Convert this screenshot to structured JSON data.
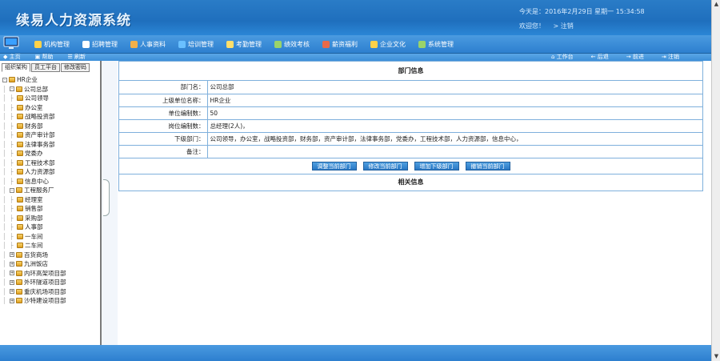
{
  "header": {
    "title": "续易人力资源系统",
    "date_line": "今天是：2016年2月29日  星期一  15:34:58",
    "welcome": "欢迎您！",
    "logout": "> 注销"
  },
  "mainnav": {
    "items": [
      {
        "label": "机构管理",
        "icon_color": "#ffd24a"
      },
      {
        "label": "招聘管理",
        "icon_color": "#ffffff"
      },
      {
        "label": "人事资料",
        "icon_color": "#f2b04a"
      },
      {
        "label": "培训管理",
        "icon_color": "#6ac0ff"
      },
      {
        "label": "考勤管理",
        "icon_color": "#ffdf6a"
      },
      {
        "label": "绩效考核",
        "icon_color": "#9ad36a"
      },
      {
        "label": "薪资福利",
        "icon_color": "#e86a4a"
      },
      {
        "label": "企业文化",
        "icon_color": "#ffd24a"
      },
      {
        "label": "系统管理",
        "icon_color": "#9ad36a"
      }
    ]
  },
  "subbar": {
    "left": [
      "◆ 主页",
      "▣ 帮助",
      "☰ 刷新"
    ],
    "right": [
      "⌂ 工作台",
      "← 后退",
      "→ 前进",
      "⇥ 注销"
    ]
  },
  "lefttabs": [
    "组织架构",
    "员工平台",
    "修改密码"
  ],
  "tree": [
    {
      "label": "HR企业",
      "depth": 0,
      "box": "-"
    },
    {
      "label": "公司总部",
      "depth": 1,
      "box": "-"
    },
    {
      "label": "公司领导",
      "depth": 2
    },
    {
      "label": "办公室",
      "depth": 2
    },
    {
      "label": "战略投资部",
      "depth": 2
    },
    {
      "label": "财务部",
      "depth": 2
    },
    {
      "label": "资产审计部",
      "depth": 2
    },
    {
      "label": "法律事务部",
      "depth": 2
    },
    {
      "label": "党委办",
      "depth": 2
    },
    {
      "label": "工程技术部",
      "depth": 2
    },
    {
      "label": "人力资源部",
      "depth": 2
    },
    {
      "label": "信息中心",
      "depth": 2
    },
    {
      "label": "工程服务厂",
      "depth": 1,
      "box": "-"
    },
    {
      "label": "经理室",
      "depth": 2
    },
    {
      "label": "销售部",
      "depth": 2
    },
    {
      "label": "采购部",
      "depth": 2
    },
    {
      "label": "人事部",
      "depth": 2
    },
    {
      "label": "一车间",
      "depth": 2
    },
    {
      "label": "二车间",
      "depth": 2
    },
    {
      "label": "百货商场",
      "depth": 1,
      "box": "+"
    },
    {
      "label": "九洲饭店",
      "depth": 1,
      "box": "+"
    },
    {
      "label": "内环高架项目部",
      "depth": 1,
      "box": "+"
    },
    {
      "label": "外环隧道项目部",
      "depth": 1,
      "box": "+"
    },
    {
      "label": "重庆机场项目部",
      "depth": 1,
      "box": "+"
    },
    {
      "label": "沙特建设项目部",
      "depth": 1,
      "box": "+"
    }
  ],
  "dept": {
    "title": "部门信息",
    "rows": [
      {
        "k": "部门名：",
        "v": "公司总部"
      },
      {
        "k": "上级单位名称：",
        "v": "HR企业"
      },
      {
        "k": "单位编制数：",
        "v": "50"
      },
      {
        "k": "岗位编制数：",
        "v": "总经理(2人)，"
      },
      {
        "k": "下级部门：",
        "v": "公司领导，办公室，战略投资部，财务部，资产审计部，法律事务部，党委办，工程技术部，人力资源部，信息中心，"
      },
      {
        "k": "备注：",
        "v": ""
      }
    ],
    "buttons": [
      "调整当前部门",
      "修改当前部门",
      "增加下级部门",
      "撤销当前部门"
    ],
    "related_title": "相关信息"
  }
}
